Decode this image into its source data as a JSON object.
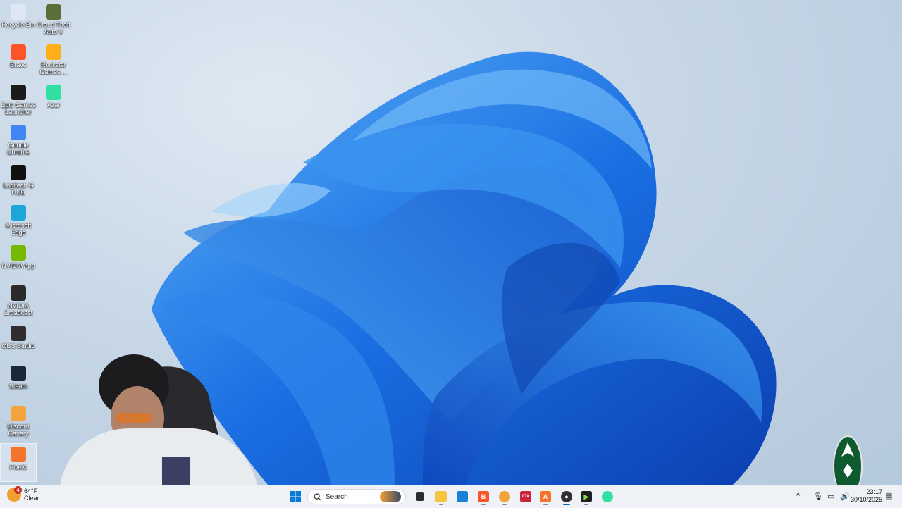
{
  "desktop_icons_col1": [
    {
      "label": "Recycle Bin",
      "icon": "recycle-bin-icon",
      "color": "#dfe8f2"
    },
    {
      "label": "Brave",
      "icon": "brave-icon",
      "color": "#fb542b"
    },
    {
      "label": "Epic Games Launcher",
      "icon": "epic-games-icon",
      "color": "#1b1b1b"
    },
    {
      "label": "Google Chrome",
      "icon": "chrome-icon",
      "color": "#4285f4"
    },
    {
      "label": "Logitech G HUB",
      "icon": "logitech-icon",
      "color": "#111111"
    },
    {
      "label": "Microsoft Edge",
      "icon": "edge-icon",
      "color": "#1fa6d8"
    },
    {
      "label": "NVIDIA App",
      "icon": "nvidia-icon",
      "color": "#76b900"
    },
    {
      "label": "NVIDIA Broadcast",
      "icon": "nvidia-broadcast-icon",
      "color": "#2a2a2a"
    },
    {
      "label": "OBS Studio",
      "icon": "obs-icon",
      "color": "#302e31"
    },
    {
      "label": "Steam",
      "icon": "steam-icon",
      "color": "#1b2838"
    },
    {
      "label": "Discord Canary",
      "icon": "discord-canary-icon",
      "color": "#f2a33a"
    },
    {
      "label": "FiveM",
      "icon": "fivem-icon",
      "color": "#f4742b"
    }
  ],
  "desktop_icons_col2": [
    {
      "label": "Grand Theft Auto V",
      "icon": "gta-v-icon",
      "color": "#5a6e3a"
    },
    {
      "label": "Rockstar Games ...",
      "icon": "rockstar-icon",
      "color": "#fcaf17"
    },
    {
      "label": "Azar",
      "icon": "azar-icon",
      "color": "#2fe0a0"
    }
  ],
  "weather": {
    "temp": "64°F",
    "condition": "Clear",
    "badge": "4"
  },
  "taskbar": {
    "search_placeholder": "Search",
    "apps": [
      {
        "name": "start-button",
        "glyph": "⊞"
      },
      {
        "name": "widgets-button",
        "glyph": "🎃"
      },
      {
        "name": "task-view-button",
        "glyph": "▣"
      },
      {
        "name": "file-explorer-button",
        "glyph": "📁"
      },
      {
        "name": "microsoft-store-button",
        "glyph": "🛍"
      },
      {
        "name": "brave-taskbar-button",
        "glyph": "B"
      },
      {
        "name": "discord-canary-taskbar-button",
        "glyph": "D"
      },
      {
        "name": "index-taskbar-button",
        "glyph": "I"
      },
      {
        "name": "fivem-taskbar-button",
        "glyph": "A"
      },
      {
        "name": "obs-taskbar-button",
        "glyph": "●"
      },
      {
        "name": "terminal-taskbar-button",
        "glyph": "▶"
      },
      {
        "name": "azar-taskbar-button",
        "glyph": "A"
      }
    ]
  },
  "tray": {
    "time": "23:17",
    "date": "30/10/2025"
  }
}
